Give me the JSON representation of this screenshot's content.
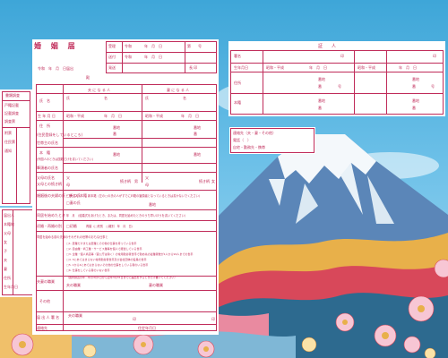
{
  "doc": {
    "title": "婚 姻 届",
    "receipt": {
      "received_label": "受理",
      "year_label": "令和",
      "date_unit": "年　月　日",
      "number_label": "第　　号",
      "sent_label": "送付",
      "delivered_label": "発送",
      "chief_label": "長 印",
      "notice_date": "令和　年　月　日届出",
      "to_label": "殿"
    },
    "side_check": {
      "title": "書類調査",
      "items": [
        "戸籍記載",
        "記載調査",
        "調査票",
        "附票",
        "住民票",
        "通知"
      ]
    },
    "columns": {
      "husband": "夫 に な る 人",
      "wife": "妻 に な る 人"
    },
    "rows": {
      "name": "氏　名",
      "birth": "生 年 月 日",
      "address": "住　所",
      "address_sub": "(住民登録をしているところ)",
      "household": "世帯主の氏名",
      "honseki": "本　籍",
      "honseki_sub": "(外国人のときは国籍だけを書いてください)",
      "head": "筆頭者の氏名",
      "parents": "父母の氏名",
      "parents_sub": "父母との続き柄",
      "new_honseki": "婚姻後の夫婦の氏・新しい本籍",
      "cohabit": "同居を始めたとき",
      "prev_marriage": "初婚・再婚の別",
      "household_job": "同居を始める前の夫婦のそれぞれの世帯のおもな仕事と",
      "job": "夫妻の職業",
      "other": "その他",
      "signer": "届 出 人 署 名",
      "contact": "連絡先"
    },
    "fill": {
      "first_name": "氏",
      "given_name": "名",
      "era": "昭和・平成",
      "ymd": "年　月　日",
      "banchi": "番地",
      "ban": "番",
      "gou": "号",
      "father": "父",
      "mother": "母",
      "relation": "続き柄",
      "male": "男",
      "female": "女",
      "husband_name": "□夫の氏",
      "wife_name": "□妻の氏",
      "new_honseki_note": "新本籍（左の□の氏の人がすでに戸籍の筆頭者となっているときは書かないでください）",
      "cohabit_date": "年　月　（結婚式をあげたとき、または、同居を始めたときのうち早いほうを書いてください）",
      "first": "□初婚",
      "remarry": "再婚（□死別　□離別　年　月　日）",
      "job_list": [
        "□1. 農業だけまたは農業とその他の仕事を持っている世帯",
        "□2. 自由業・商工業・サービス業等を個人で経営している世帯",
        "□3. 企業・個人商店等（官公庁は除く）の常用勤労者世帯で勤め先の従業者数が1人から99人までの世帯",
        "□4. 3にあてはまらない常用勤労者世帯及び会社団体の役員の世帯",
        "□5. 1から4にあてはまらないその他の仕事をしている者のいる世帯",
        "□6. 仕事をしている者のいない世帯"
      ],
      "job_note": "（国勢調査の年…年の4月1日から翌年3月31日までに届出をするときだけ書いてください）",
      "husband_job": "夫の職業",
      "wife_job": "妻の職業",
      "seal": "印",
      "residency": "住定年月日",
      "call": "電話",
      "home": "自宅・勤務先・携帯"
    },
    "witness": {
      "title": "証　　人",
      "sign": "署名",
      "birth": "生年月日",
      "address": "住所",
      "honseki": "本籍",
      "era": "昭和・平成",
      "ymd": "年　月　日",
      "banchi": "番地",
      "ban": "番",
      "gou": "号",
      "seal": "印"
    },
    "contact_box": {
      "title": "連絡先（夫・妻・その他）",
      "phone": "電話（　）",
      "home": "自宅・勤務先・携帯"
    },
    "left_form": {
      "items": [
        "届出人",
        "本籍地",
        "父母",
        "女",
        "子",
        "夫",
        "妻",
        "住所",
        "生年月日",
        "国籍"
      ]
    }
  },
  "colors": {
    "sky_top": "#3ea6d8",
    "form_line": "#c02c5a",
    "fuji_snow": "#f4f8fb",
    "fuji_body": "#5b86b8",
    "wave_red": "#d8485a",
    "wave_gold": "#e8b04a"
  }
}
